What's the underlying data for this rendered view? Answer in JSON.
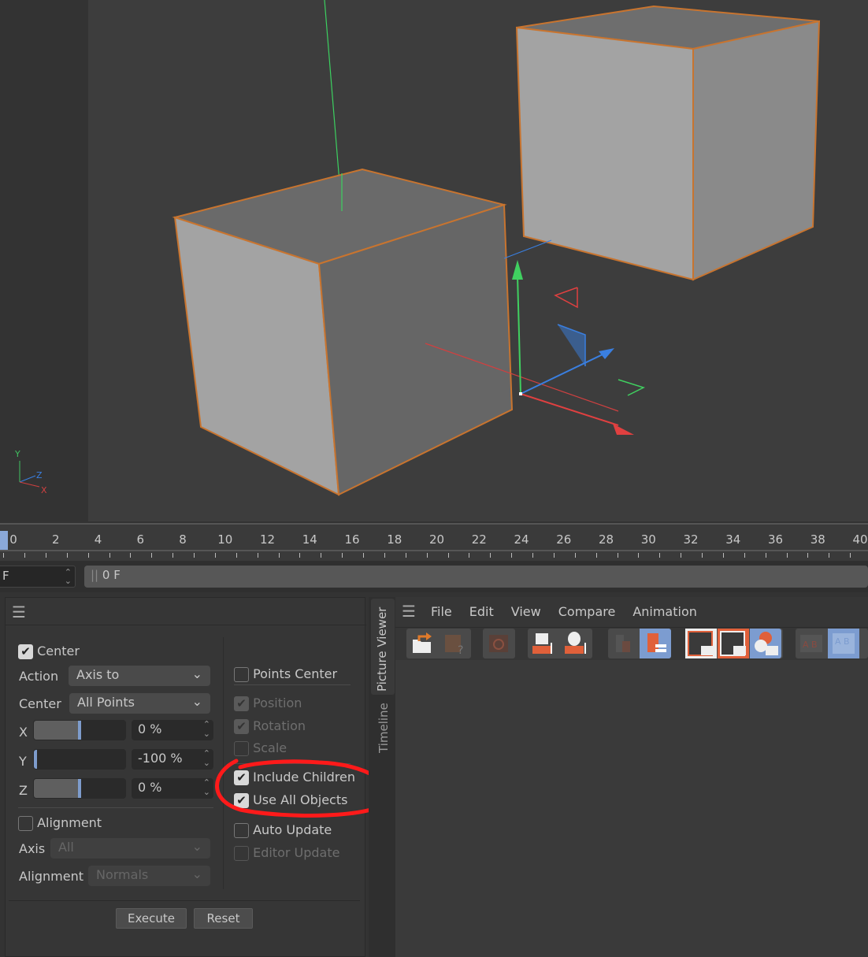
{
  "timeline": {
    "ticks": [
      "0",
      "2",
      "4",
      "6",
      "8",
      "10",
      "12",
      "14",
      "16",
      "18",
      "20",
      "22",
      "24",
      "26",
      "28",
      "30",
      "32",
      "34",
      "36",
      "38",
      "40"
    ],
    "current_frame_field": "F",
    "frame_slider_value": "0 F"
  },
  "viewport": {
    "axis_labels": {
      "y": "Y",
      "z": "Z",
      "x": "X"
    },
    "colors": {
      "selection_outline": "#c8742f",
      "x_axis": "#e04040",
      "y_axis": "#40d060",
      "z_axis": "#3a7fe0"
    }
  },
  "attributes": {
    "center_label": "Center",
    "center_checked": true,
    "action_label": "Action",
    "action_value": "Axis to",
    "center_mode_label": "Center",
    "center_mode_value": "All Points",
    "x_label": "X",
    "x_value": "0 %",
    "x_fraction": 0.5,
    "y_label": "Y",
    "y_value": "-100 %",
    "y_fraction": 0.0,
    "z_label": "Z",
    "z_value": "0 %",
    "z_fraction": 0.5,
    "alignment_label": "Alignment",
    "alignment_checked": false,
    "axis_label": "Axis",
    "axis_value": "All",
    "alignment_mode_label": "Alignment",
    "alignment_mode_value": "Normals",
    "options": [
      {
        "label": "Points Center",
        "checked": false,
        "enabled": true
      },
      {
        "label": "Position",
        "checked": true,
        "enabled": false
      },
      {
        "label": "Rotation",
        "checked": true,
        "enabled": false
      },
      {
        "label": "Scale",
        "checked": false,
        "enabled": false
      },
      {
        "label": "Include Children",
        "checked": true,
        "enabled": true
      },
      {
        "label": "Use All Objects",
        "checked": true,
        "enabled": true
      },
      {
        "label": "Auto Update",
        "checked": false,
        "enabled": true
      },
      {
        "label": "Editor Update",
        "checked": false,
        "enabled": false
      }
    ],
    "execute_label": "Execute",
    "reset_label": "Reset"
  },
  "picture_viewer": {
    "tabs": [
      "Picture Viewer",
      "Timeline"
    ],
    "menu": [
      "File",
      "Edit",
      "View",
      "Compare",
      "Animation"
    ],
    "toolbar_icons": [
      "open-file-icon",
      "save-as-icon",
      "stop-render-icon",
      "add-channel-icon",
      "add-layer-icon",
      "delete-icon",
      "filmstrip-icon",
      "view-a-icon",
      "view-b-icon",
      "color-compare-icon",
      "ab-compare-icon",
      "ab-split-icon"
    ]
  },
  "annotation": {
    "color": "#ff1a1a"
  }
}
